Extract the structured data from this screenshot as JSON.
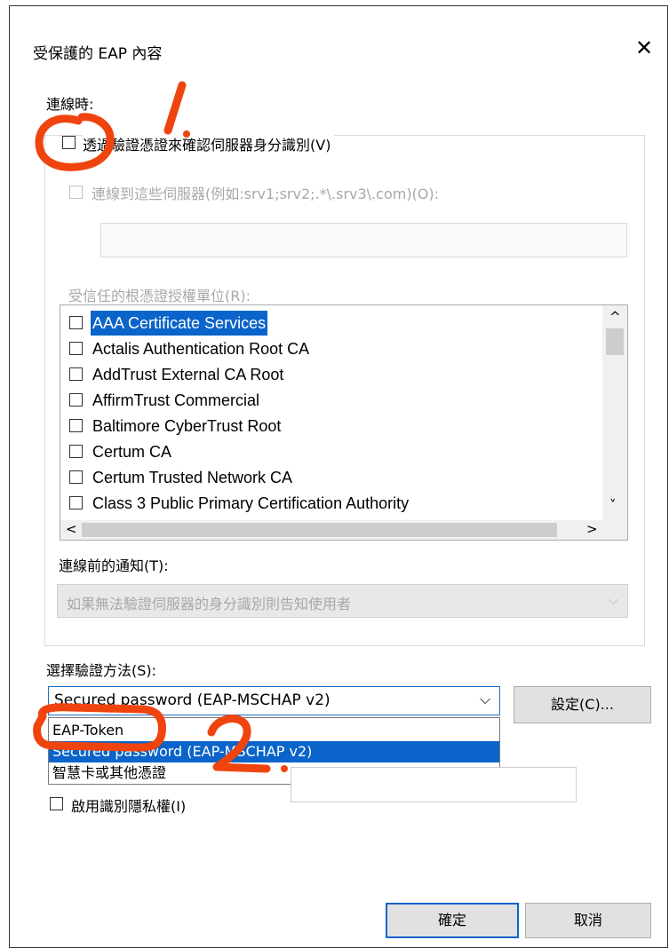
{
  "window": {
    "title": "受保護的 EAP 內容",
    "close_glyph": "✕"
  },
  "connection_section": {
    "label": "連線時:",
    "verify_server_label": "透過驗證憑證來確認伺服器身分識別(V)",
    "connect_to_servers_label": "連線到這些伺服器(例如:srv1;srv2;.*\\.srv3\\.com)(O):",
    "servers_value": "",
    "trusted_ca_label": "受信任的根憑證授權單位(R):",
    "trusted_ca_list": [
      {
        "label": "AAA Certificate Services",
        "checked": false,
        "selected": true
      },
      {
        "label": "Actalis Authentication Root CA",
        "checked": false,
        "selected": false
      },
      {
        "label": "AddTrust External CA Root",
        "checked": false,
        "selected": false
      },
      {
        "label": "AffirmTrust Commercial",
        "checked": false,
        "selected": false
      },
      {
        "label": "Baltimore CyberTrust Root",
        "checked": false,
        "selected": false
      },
      {
        "label": "Certum CA",
        "checked": false,
        "selected": false
      },
      {
        "label": "Certum Trusted Network CA",
        "checked": false,
        "selected": false
      },
      {
        "label": "Class 3 Public Primary Certification Authority",
        "checked": false,
        "selected": false
      }
    ],
    "notify_label": "連線前的通知(T):",
    "notify_value": "如果無法驗證伺服器的身分識別則告知使用者"
  },
  "auth_method": {
    "label": "選擇驗證方法(S):",
    "selected_value": "Secured password (EAP-MSCHAP v2)",
    "configure_button": "設定(C)...",
    "options": [
      {
        "label": "EAP-Token",
        "selected": false
      },
      {
        "label": "Secured password (EAP-MSCHAP v2)",
        "selected": true
      },
      {
        "label": "智慧卡或其他憑證",
        "selected": false
      }
    ]
  },
  "identity_privacy": {
    "label": "啟用識別隱私權(I)",
    "value": ""
  },
  "footer": {
    "ok_label": "確定",
    "cancel_label": "取消"
  },
  "icons": {
    "scroll_up": "^",
    "scroll_down": "˅",
    "scroll_left": "<",
    "scroll_right": ">",
    "dropdown": "⌵"
  },
  "annotations": {
    "step1": "1.",
    "step2": "2."
  },
  "colors": {
    "selection": "#0a64c9",
    "annotation": "#f0440e",
    "focus_border": "#1f6fc6"
  }
}
